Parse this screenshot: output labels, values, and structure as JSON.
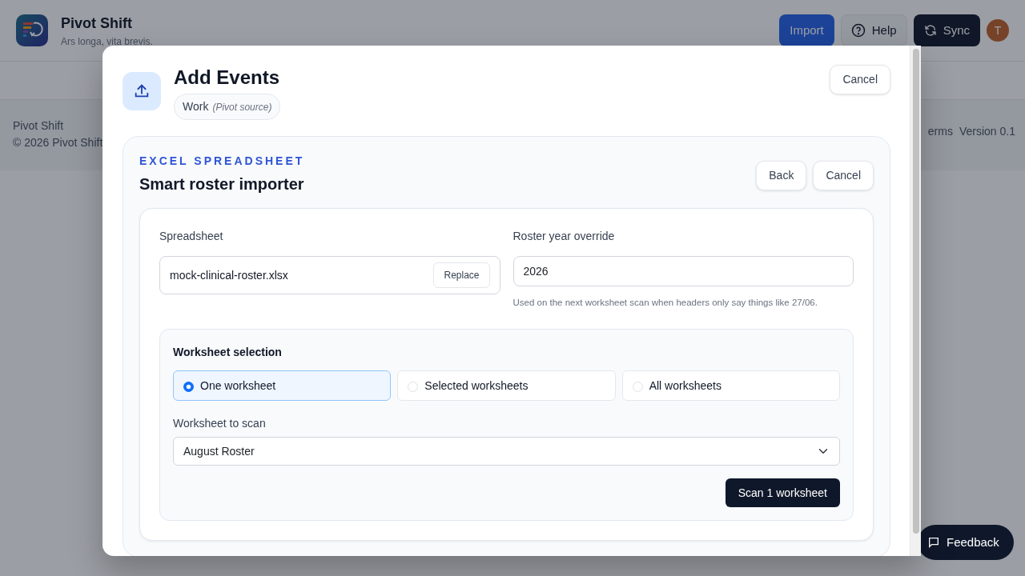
{
  "app": {
    "title": "Pivot Shift",
    "tagline": "Ars longa, vita brevis.",
    "actions": [
      {
        "label": "Import",
        "kind": "primary"
      },
      {
        "label": "Help",
        "kind": "help"
      },
      {
        "label": "Sync",
        "kind": "sync"
      }
    ],
    "avatar": "T"
  },
  "footer": {
    "name": "Pivot Shift",
    "copyright": "© 2026 Pivot Shift",
    "links": [
      "erms",
      "Version 0.1"
    ]
  },
  "feedback": "Feedback",
  "modal": {
    "title": "Add Events",
    "source_label": "Work",
    "source_note": "(Pivot source)",
    "cancel": "Cancel",
    "importer": {
      "eyebrow": "EXCEL SPREADSHEET",
      "title": "Smart roster importer",
      "buttons": [
        "Back",
        "Cancel"
      ],
      "spreadsheet": {
        "label": "Spreadsheet",
        "file": "mock-clinical-roster.xlsx",
        "replace": "Replace"
      },
      "year": {
        "label": "Roster year override",
        "value": "2026",
        "help": "Used on the next worksheet scan when headers only say things like 27/06."
      },
      "selection": {
        "title": "Worksheet selection",
        "options": [
          {
            "label": "One worksheet",
            "selected": true
          },
          {
            "label": "Selected worksheets",
            "selected": false
          },
          {
            "label": "All worksheets",
            "selected": false
          }
        ],
        "sheet_label": "Worksheet to scan",
        "sheet_value": "August Roster",
        "scan": "Scan 1 worksheet"
      }
    }
  }
}
